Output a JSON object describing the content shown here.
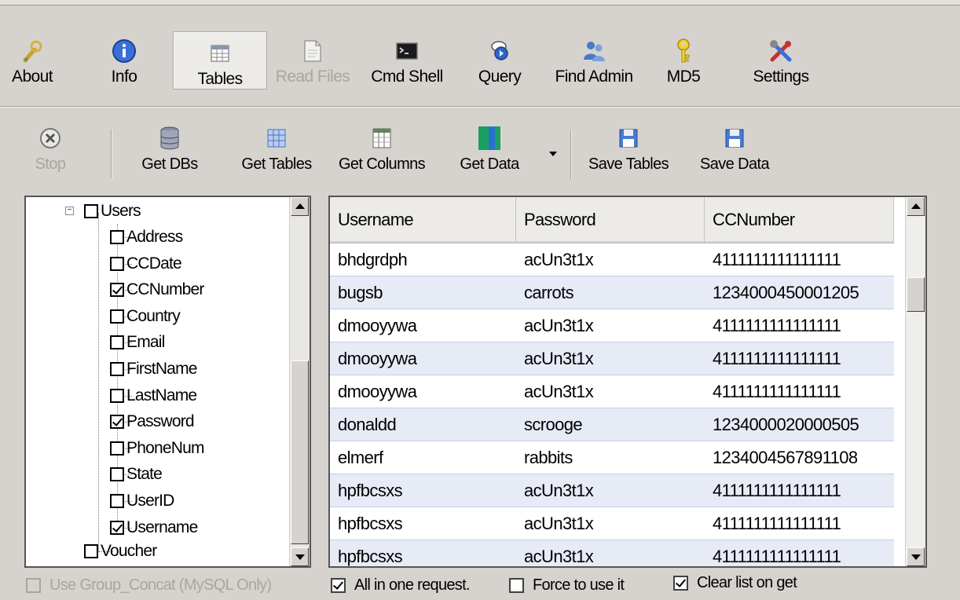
{
  "main_toolbar": {
    "buttons": [
      {
        "label": "About",
        "icon": "wrench-shield-icon"
      },
      {
        "label": "Info",
        "icon": "info-icon"
      },
      {
        "label": "Tables",
        "icon": "table-icon",
        "state": "active"
      },
      {
        "label": "Read Files",
        "icon": "document-icon",
        "state": "disabled"
      },
      {
        "label": "Cmd Shell",
        "icon": "terminal-icon"
      },
      {
        "label": "Query",
        "icon": "query-icon"
      },
      {
        "label": "Find Admin",
        "icon": "admin-users-icon"
      },
      {
        "label": "MD5",
        "icon": "key-icon"
      },
      {
        "label": "Settings",
        "icon": "settings-tools-icon"
      }
    ]
  },
  "sub_toolbar": {
    "buttons": [
      {
        "label": "Stop",
        "icon": "stop-icon",
        "state": "disabled"
      },
      {
        "label": "Get DBs",
        "icon": "database-icon"
      },
      {
        "label": "Get Tables",
        "icon": "grid-table-icon"
      },
      {
        "label": "Get Columns",
        "icon": "columns-icon"
      },
      {
        "label": "Get Data",
        "icon": "data-icon"
      },
      {
        "label": "Save Tables",
        "icon": "floppy-icon"
      },
      {
        "label": "Save Data",
        "icon": "floppy-icon"
      }
    ]
  },
  "tree": {
    "parent": {
      "label": "Users",
      "checked": false
    },
    "children": [
      {
        "label": "Address",
        "checked": false
      },
      {
        "label": "CCDate",
        "checked": false
      },
      {
        "label": "CCNumber",
        "checked": true
      },
      {
        "label": "Country",
        "checked": false
      },
      {
        "label": "Email",
        "checked": false
      },
      {
        "label": "FirstName",
        "checked": false
      },
      {
        "label": "LastName",
        "checked": false
      },
      {
        "label": "Password",
        "checked": true
      },
      {
        "label": "PhoneNum",
        "checked": false
      },
      {
        "label": "State",
        "checked": false
      },
      {
        "label": "UserID",
        "checked": false
      },
      {
        "label": "Username",
        "checked": true
      }
    ],
    "sibling": {
      "label": "Voucher",
      "checked": false
    }
  },
  "grid": {
    "columns": [
      "Username",
      "Password",
      "CCNumber"
    ],
    "rows": [
      [
        "bhdgrdph",
        "acUn3t1x",
        "4111111111111111"
      ],
      [
        "bugsb",
        "carrots",
        "1234000450001205"
      ],
      [
        "dmooyywa",
        "acUn3t1x",
        "4111111111111111"
      ],
      [
        "dmooyywa",
        "acUn3t1x",
        "4111111111111111"
      ],
      [
        "dmooyywa",
        "acUn3t1x",
        "4111111111111111"
      ],
      [
        "donaldd",
        "scrooge",
        "1234000020000505"
      ],
      [
        "elmerf",
        "rabbits",
        "1234004567891108"
      ],
      [
        "hpfbcsxs",
        "acUn3t1x",
        "4111111111111111"
      ],
      [
        "hpfbcsxs",
        "acUn3t1x",
        "4111111111111111"
      ],
      [
        "hpfbcsxs",
        "acUn3t1x",
        "4111111111111111"
      ]
    ]
  },
  "options": {
    "group_concat": {
      "label": "Use Group_Concat (MySQL Only)",
      "checked": false,
      "disabled": true
    },
    "all_in_one": {
      "label": "All in one request.",
      "checked": true
    },
    "force_use": {
      "label": "Force to use it",
      "checked": false
    },
    "clear_list": {
      "label": "Clear list on get",
      "checked": true
    }
  },
  "colors": {
    "background": "#d6d3ce",
    "alt_row": "#e6ebf5",
    "disabled_text": "#a8a6a1"
  }
}
